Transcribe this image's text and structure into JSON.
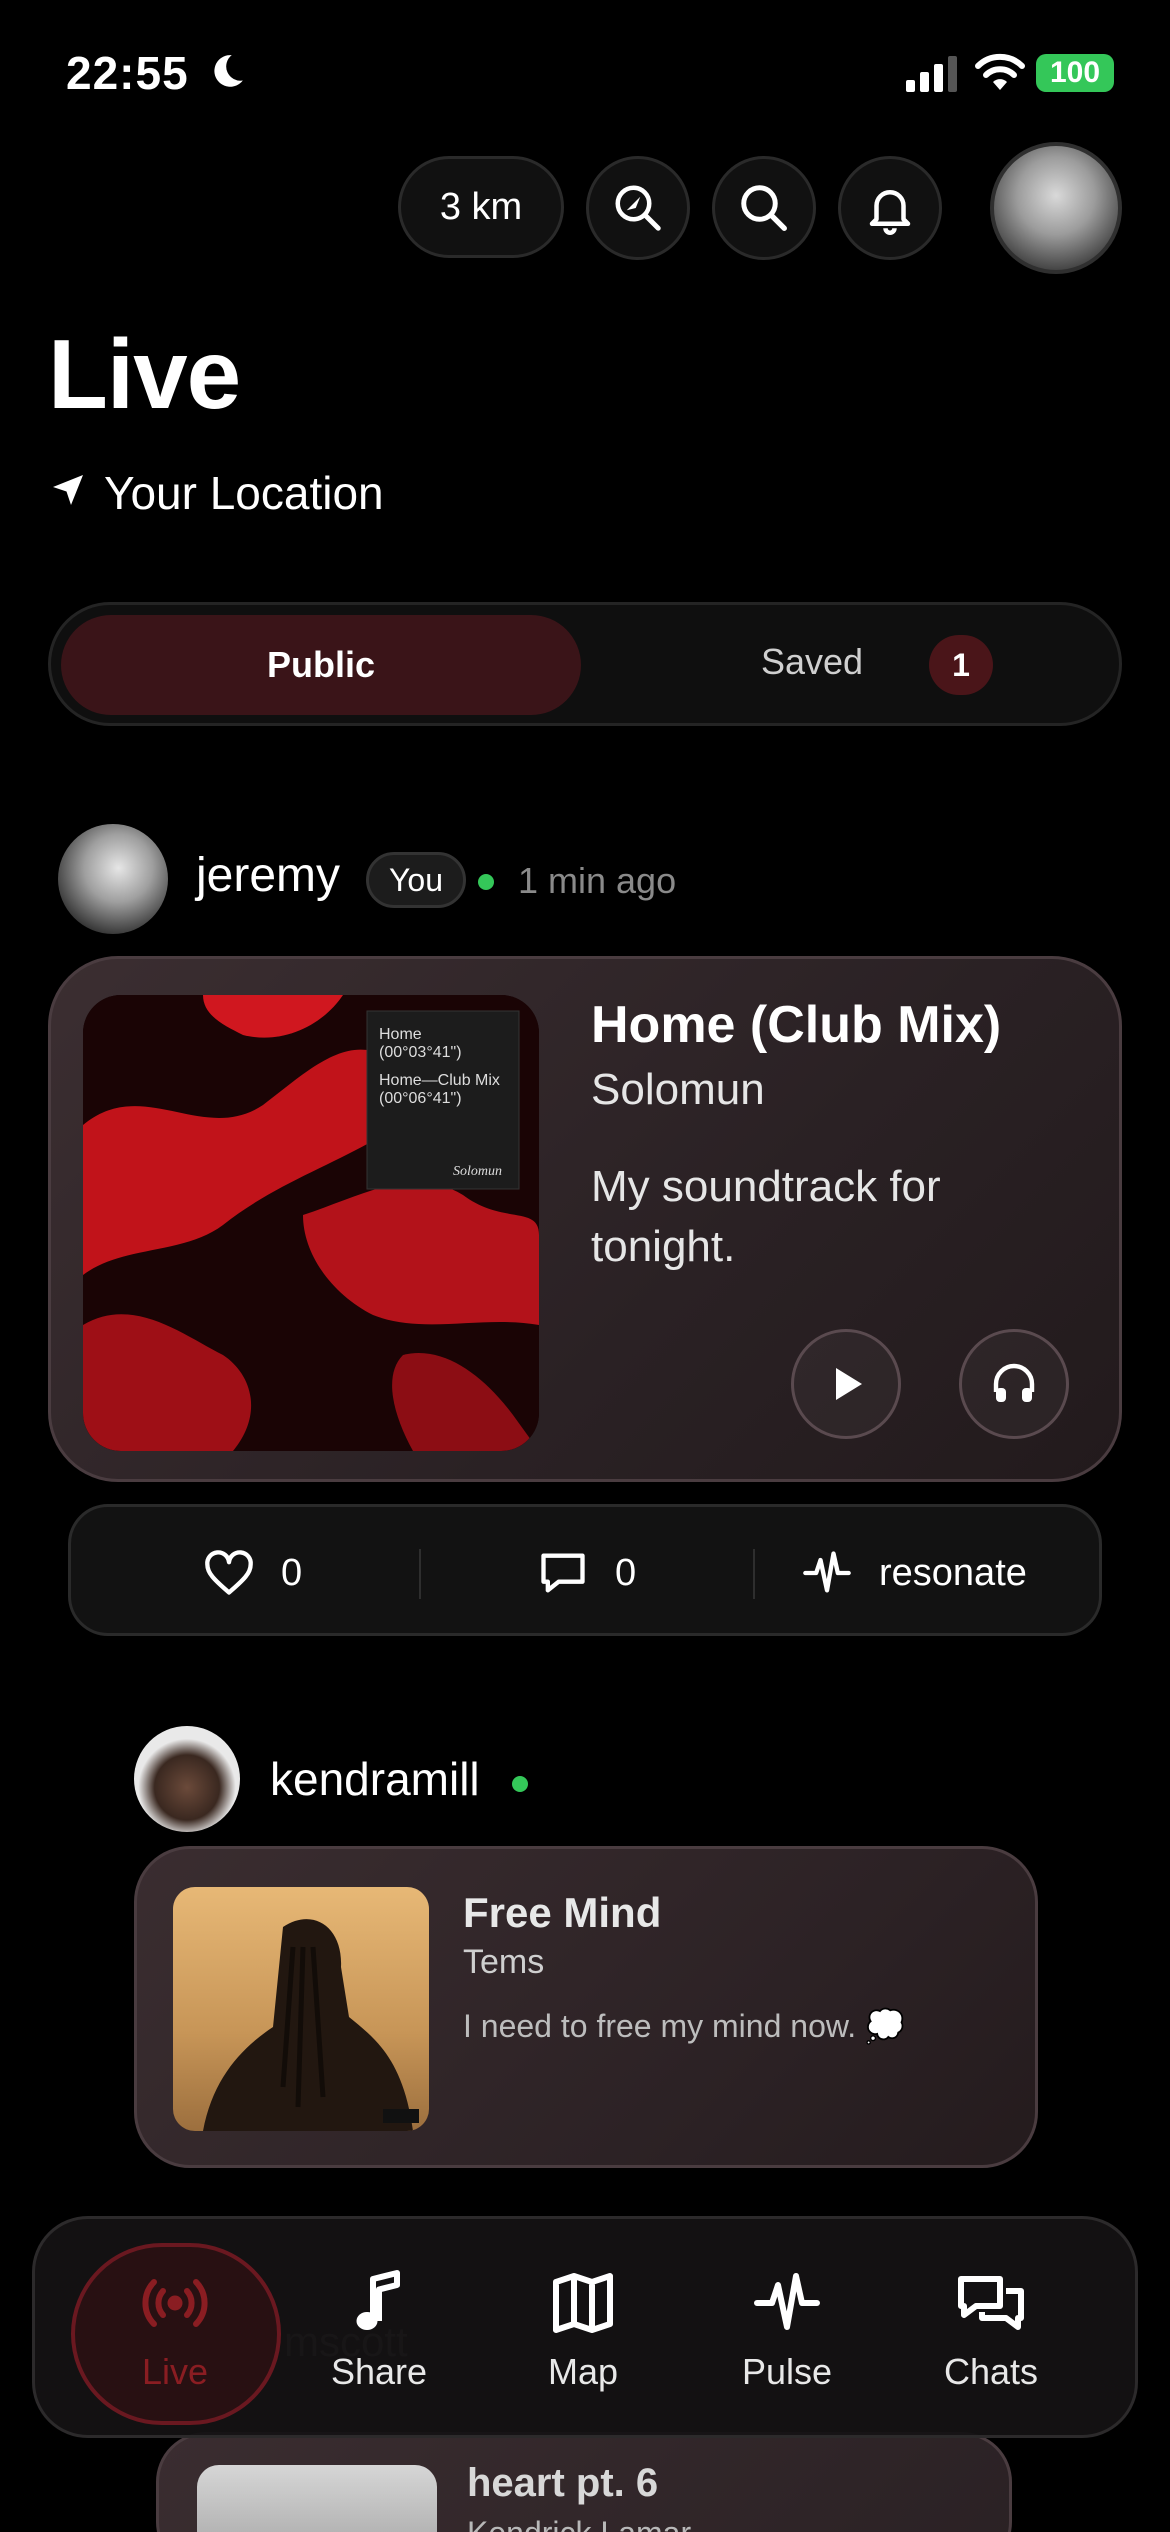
{
  "status_bar": {
    "time": "22:55",
    "battery": "100"
  },
  "header": {
    "distance": "3 km",
    "title": "Live",
    "location": "Your Location"
  },
  "segments": {
    "public": "Public",
    "saved": "Saved",
    "saved_count": "1"
  },
  "posts": [
    {
      "user": "jeremy",
      "badge": "You",
      "time": "1 min ago",
      "song": "Home (Club Mix)",
      "artist": "Solomun",
      "note": "My soundtrack for tonight.",
      "likes": "0",
      "comments": "0",
      "resonate": "resonate"
    },
    {
      "user": "kendramill",
      "song": "Free Mind",
      "artist": "Tems",
      "note": "I need to free my mind now. 💭"
    },
    {
      "user": "mscott",
      "song": "heart pt. 6",
      "artist": "Kendrick Lamar"
    }
  ],
  "tabs": [
    {
      "label": "Live",
      "icon": "broadcast-icon",
      "active": true
    },
    {
      "label": "Share",
      "icon": "music-note-icon"
    },
    {
      "label": "Map",
      "icon": "map-icon"
    },
    {
      "label": "Pulse",
      "icon": "pulse-icon"
    },
    {
      "label": "Chats",
      "icon": "chat-bubbles-icon"
    }
  ],
  "colors": {
    "accent": "#8a1d22",
    "online": "#34c759",
    "background": "#000000"
  }
}
